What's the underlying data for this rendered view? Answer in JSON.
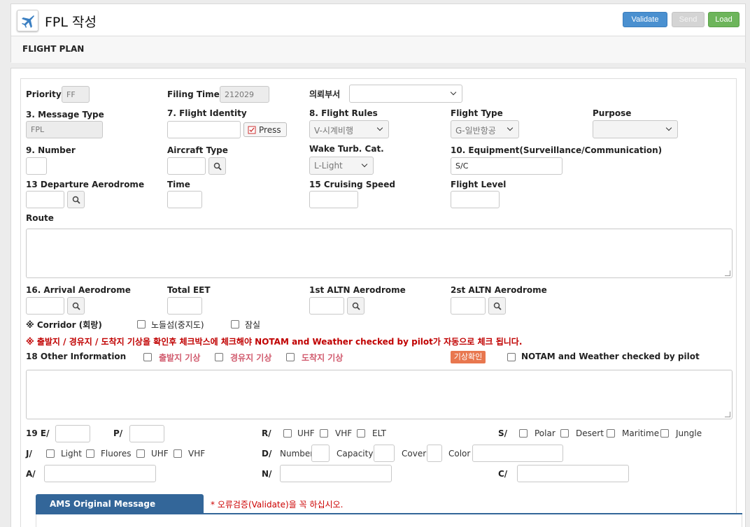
{
  "app": {
    "title": "FPL 작성",
    "buttons": {
      "validate": "Validate",
      "send": "Send",
      "load": "Load"
    },
    "section": "FLIGHT PLAN"
  },
  "form": {
    "priority": {
      "label": "Priority",
      "value": "FF"
    },
    "filing_time": {
      "label": "Filing Time",
      "value": "212029"
    },
    "dept": {
      "label": "의뢰부서",
      "value": ""
    },
    "message_type": {
      "label": "3. Message Type",
      "value": "FPL"
    },
    "flight_identity": {
      "label": "7. Flight Identity",
      "value": "",
      "press": "Press"
    },
    "flight_rules": {
      "label": "8. Flight Rules",
      "value": "V-시계비행"
    },
    "flight_type": {
      "label": "Flight Type",
      "value": "G-일반항공"
    },
    "purpose": {
      "label": "Purpose",
      "value": ""
    },
    "number": {
      "label": "9. Number",
      "value": ""
    },
    "aircraft_type": {
      "label": "Aircraft Type",
      "value": ""
    },
    "wake": {
      "label": "Wake Turb. Cat.",
      "value": "L-Light"
    },
    "equipment": {
      "label": "10. Equipment(Surveillance/Communication)",
      "value": "S/C"
    },
    "departure": {
      "label": "13 Departure Aerodrome",
      "value": ""
    },
    "time": {
      "label": "Time",
      "value": ""
    },
    "cruising_speed": {
      "label": "15 Cruising Speed",
      "value": ""
    },
    "flight_level": {
      "label": "Flight Level",
      "value": ""
    },
    "route": {
      "label": "Route",
      "value": ""
    },
    "arrival": {
      "label": "16. Arrival Aerodrome",
      "value": ""
    },
    "total_eet": {
      "label": "Total EET",
      "value": ""
    },
    "altn1": {
      "label": "1st ALTN Aerodrome",
      "value": ""
    },
    "altn2": {
      "label": "2st ALTN Aerodrome",
      "value": ""
    },
    "corridor": {
      "label": "※ Corridor (회랑)",
      "opt1": "노들섬(중지도)",
      "opt2": "잠실"
    },
    "warning": "※ 출발지 / 경유지 / 도착지 기상을 확인후 체크박스에 체크해야 NOTAM and Weather checked by pilot가 자동으로 체크 됩니다.",
    "other_info": {
      "label": "18 Other Information",
      "dep_wx": "출발지 기상",
      "enroute_wx": "경유지 기상",
      "arr_wx": "도착지 기상",
      "wx_button": "기상확인",
      "notam": "NOTAM and Weather checked by pilot",
      "value": ""
    },
    "item19": {
      "e": "19 E/",
      "p": "P/",
      "r": "R/",
      "s": "S/",
      "r_opts": [
        "UHF",
        "VHF",
        "ELT"
      ],
      "s_opts": [
        "Polar",
        "Desert",
        "Maritime",
        "Jungle"
      ],
      "j": "J/",
      "j_opts": [
        "Light",
        "Fluores",
        "UHF",
        "VHF"
      ],
      "d": "D/",
      "d_number": "Number",
      "d_capacity": "Capacity",
      "d_cover": "Cover",
      "d_color": "Color",
      "a": "A/",
      "n": "N/",
      "c": "C/"
    }
  },
  "ams": {
    "tab": "AMS Original Message",
    "note": "* 오류검증(Validate)을 꼭 하십시오."
  },
  "colors": {
    "validate": "#4a90d0",
    "send": "#d4d4d4",
    "load": "#6db55b",
    "wx_button": "#e8774f",
    "tab": "#336699",
    "warning": "#c00000"
  }
}
